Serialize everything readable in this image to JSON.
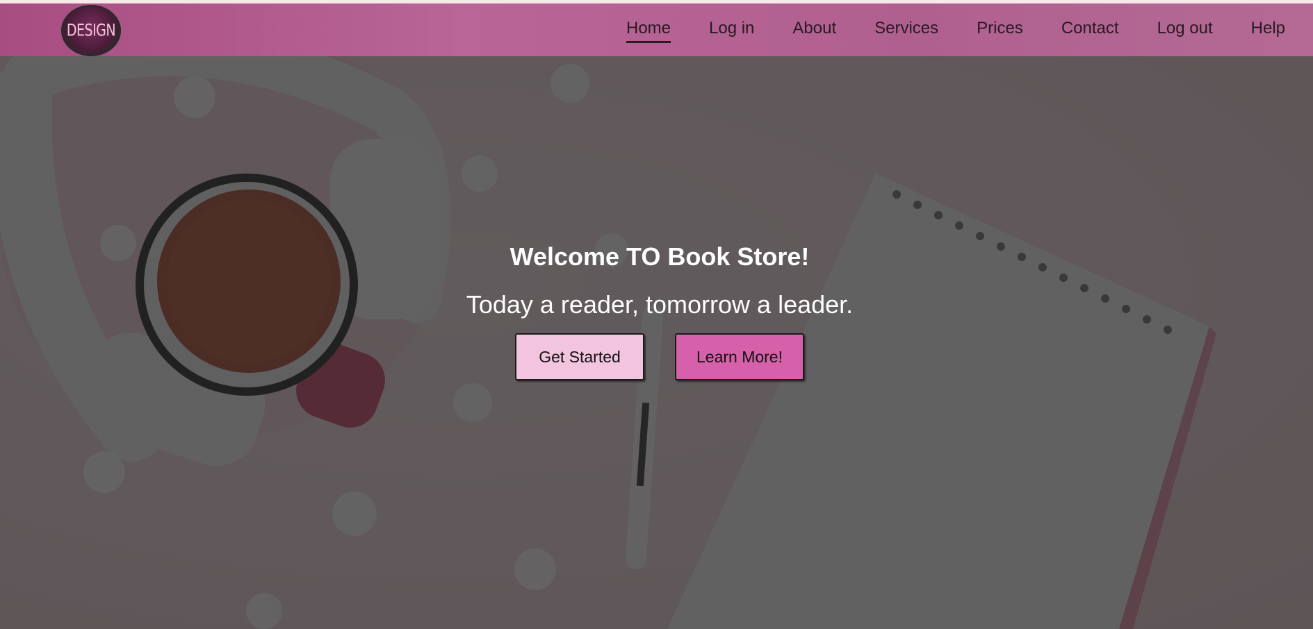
{
  "brand": {
    "logo_text": "DESIGN"
  },
  "nav": {
    "items": [
      {
        "label": "Home",
        "active": true
      },
      {
        "label": "Log in",
        "active": false
      },
      {
        "label": "About",
        "active": false
      },
      {
        "label": "Services",
        "active": false
      },
      {
        "label": "Prices",
        "active": false
      },
      {
        "label": "Contact",
        "active": false
      },
      {
        "label": "Log out",
        "active": false
      },
      {
        "label": "Help",
        "active": false
      }
    ]
  },
  "hero": {
    "title": "Welcome TO Book Store!",
    "subtitle": "Today a reader, tomorrow a leader.",
    "primary_button": "Get Started",
    "secondary_button": "Learn More!"
  },
  "colors": {
    "navbar": "#b0608f",
    "primary_button": "#f2c4df",
    "secondary_button": "#d660a9",
    "overlay": "#282828"
  },
  "icons": {
    "logo": "design-logo-badge",
    "background": "tea-cup-headphones-notebook-photo"
  }
}
